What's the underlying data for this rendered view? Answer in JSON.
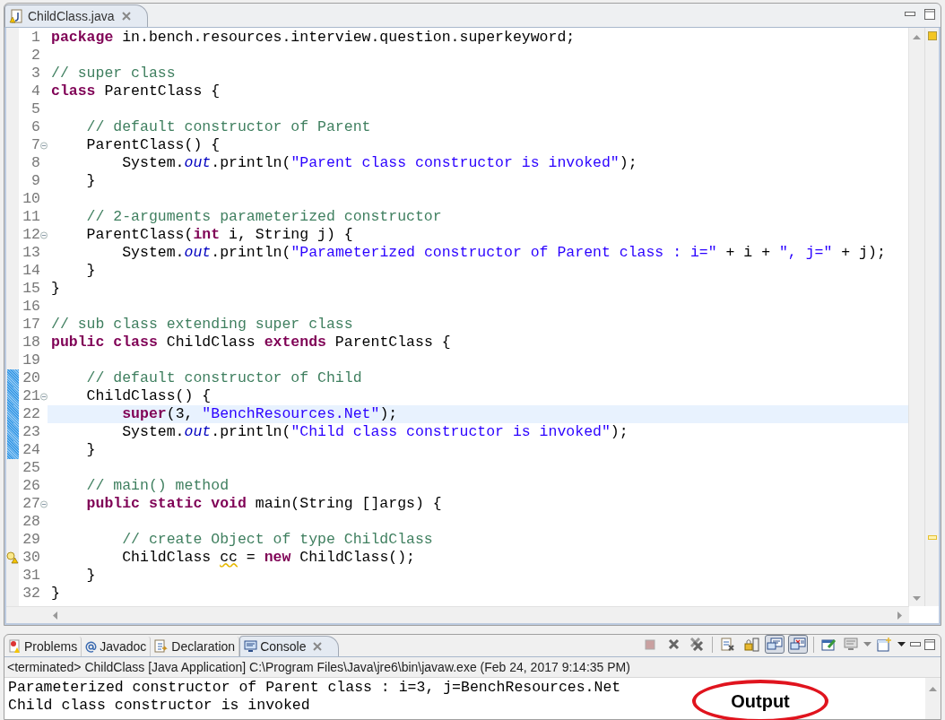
{
  "editor_tab": {
    "label": "ChildClass.java",
    "selected": true
  },
  "lines": [
    {
      "n": "1",
      "fold": false,
      "changed": false,
      "current": false,
      "warning": false,
      "tokens": [
        {
          "kind": "kw",
          "text": "package"
        },
        {
          "kind": "plain",
          "text": " in.bench.resources.interview.question.superkeyword;"
        }
      ]
    },
    {
      "n": "2",
      "fold": false,
      "changed": false,
      "current": false,
      "warning": false
    },
    {
      "n": "3",
      "fold": false,
      "changed": false,
      "current": false,
      "warning": false,
      "tokens": [
        {
          "kind": "comment",
          "text": "// super class"
        }
      ]
    },
    {
      "n": "4",
      "fold": false,
      "changed": false,
      "current": false,
      "warning": false,
      "tokens": [
        {
          "kind": "kw",
          "text": "class"
        },
        {
          "kind": "plain",
          "text": " ParentClass {"
        }
      ]
    },
    {
      "n": "5",
      "fold": false,
      "changed": false,
      "current": false,
      "warning": false
    },
    {
      "n": "6",
      "fold": false,
      "changed": false,
      "current": false,
      "warning": false,
      "tokens": [
        {
          "kind": "comment",
          "text": "    // default constructor of Parent"
        }
      ]
    },
    {
      "n": "7",
      "fold": true,
      "changed": false,
      "current": false,
      "warning": false,
      "tokens": [
        {
          "kind": "plain",
          "text": "    ParentClass() {"
        }
      ]
    },
    {
      "n": "8",
      "fold": false,
      "changed": false,
      "current": false,
      "warning": false,
      "tokens": [
        {
          "kind": "plain",
          "text": "        System."
        },
        {
          "kind": "field",
          "text": "out"
        },
        {
          "kind": "plain",
          "text": ".println("
        },
        {
          "kind": "string",
          "text": "\"Parent class constructor is invoked\""
        },
        {
          "kind": "plain",
          "text": ");"
        }
      ]
    },
    {
      "n": "9",
      "fold": false,
      "changed": false,
      "current": false,
      "warning": false,
      "tokens": [
        {
          "kind": "plain",
          "text": "    }"
        }
      ]
    },
    {
      "n": "10",
      "fold": false,
      "changed": false,
      "current": false,
      "warning": false
    },
    {
      "n": "11",
      "fold": false,
      "changed": false,
      "current": false,
      "warning": false,
      "tokens": [
        {
          "kind": "comment",
          "text": "    // 2-arguments parameterized constructor"
        }
      ]
    },
    {
      "n": "12",
      "fold": true,
      "changed": false,
      "current": false,
      "warning": false,
      "tokens": [
        {
          "kind": "plain",
          "text": "    ParentClass("
        },
        {
          "kind": "kw",
          "text": "int"
        },
        {
          "kind": "plain",
          "text": " i, String j) {"
        }
      ]
    },
    {
      "n": "13",
      "fold": false,
      "changed": false,
      "current": false,
      "warning": false,
      "tokens": [
        {
          "kind": "plain",
          "text": "        System."
        },
        {
          "kind": "field",
          "text": "out"
        },
        {
          "kind": "plain",
          "text": ".println("
        },
        {
          "kind": "string",
          "text": "\"Parameterized constructor of Parent class : i=\""
        },
        {
          "kind": "plain",
          "text": " + i + "
        },
        {
          "kind": "string",
          "text": "\", j=\""
        },
        {
          "kind": "plain",
          "text": " + j);"
        }
      ]
    },
    {
      "n": "14",
      "fold": false,
      "changed": false,
      "current": false,
      "warning": false,
      "tokens": [
        {
          "kind": "plain",
          "text": "    }"
        }
      ]
    },
    {
      "n": "15",
      "fold": false,
      "changed": false,
      "current": false,
      "warning": false,
      "tokens": [
        {
          "kind": "plain",
          "text": "}"
        }
      ]
    },
    {
      "n": "16",
      "fold": false,
      "changed": false,
      "current": false,
      "warning": false
    },
    {
      "n": "17",
      "fold": false,
      "changed": false,
      "current": false,
      "warning": false,
      "tokens": [
        {
          "kind": "comment",
          "text": "// sub class extending super class"
        }
      ]
    },
    {
      "n": "18",
      "fold": false,
      "changed": false,
      "current": false,
      "warning": false,
      "tokens": [
        {
          "kind": "kw",
          "text": "public class"
        },
        {
          "kind": "plain",
          "text": " ChildClass "
        },
        {
          "kind": "kw",
          "text": "extends"
        },
        {
          "kind": "plain",
          "text": " ParentClass {"
        }
      ]
    },
    {
      "n": "19",
      "fold": false,
      "changed": false,
      "current": false,
      "warning": false
    },
    {
      "n": "20",
      "fold": false,
      "changed": true,
      "current": false,
      "warning": false,
      "tokens": [
        {
          "kind": "comment",
          "text": "    // default constructor of Child"
        }
      ]
    },
    {
      "n": "21",
      "fold": true,
      "changed": true,
      "current": false,
      "warning": false,
      "tokens": [
        {
          "kind": "plain",
          "text": "    ChildClass() {"
        }
      ]
    },
    {
      "n": "22",
      "fold": false,
      "changed": true,
      "current": true,
      "warning": false,
      "tokens": [
        {
          "kind": "kw",
          "text": "        super"
        },
        {
          "kind": "plain",
          "text": "(3, "
        },
        {
          "kind": "string",
          "text": "\"BenchResources.Net\""
        },
        {
          "kind": "plain",
          "text": ");"
        }
      ]
    },
    {
      "n": "23",
      "fold": false,
      "changed": true,
      "current": false,
      "warning": false,
      "tokens": [
        {
          "kind": "plain",
          "text": "        System."
        },
        {
          "kind": "field",
          "text": "out"
        },
        {
          "kind": "plain",
          "text": ".println("
        },
        {
          "kind": "string",
          "text": "\"Child class constructor is invoked\""
        },
        {
          "kind": "plain",
          "text": ");"
        }
      ]
    },
    {
      "n": "24",
      "fold": false,
      "changed": true,
      "current": false,
      "warning": false,
      "tokens": [
        {
          "kind": "plain",
          "text": "    }"
        }
      ]
    },
    {
      "n": "25",
      "fold": false,
      "changed": false,
      "current": false,
      "warning": false
    },
    {
      "n": "26",
      "fold": false,
      "changed": false,
      "current": false,
      "warning": false,
      "tokens": [
        {
          "kind": "comment",
          "text": "    // main() method"
        }
      ]
    },
    {
      "n": "27",
      "fold": true,
      "changed": false,
      "current": false,
      "warning": false,
      "tokens": [
        {
          "kind": "kw",
          "text": "    public static void"
        },
        {
          "kind": "plain",
          "text": " main(String []args) {"
        }
      ]
    },
    {
      "n": "28",
      "fold": false,
      "changed": false,
      "current": false,
      "warning": false
    },
    {
      "n": "29",
      "fold": false,
      "changed": false,
      "current": false,
      "warning": false,
      "tokens": [
        {
          "kind": "comment",
          "text": "        // create Object of type ChildClass"
        }
      ]
    },
    {
      "n": "30",
      "fold": false,
      "changed": false,
      "current": false,
      "warning": true,
      "tokens": [
        {
          "kind": "plain",
          "text": "        ChildClass "
        },
        {
          "kind": "warn",
          "text": "cc"
        },
        {
          "kind": "plain",
          "text": " = "
        },
        {
          "kind": "kw",
          "text": "new"
        },
        {
          "kind": "plain",
          "text": " ChildClass();"
        }
      ]
    },
    {
      "n": "31",
      "fold": false,
      "changed": false,
      "current": false,
      "warning": false,
      "tokens": [
        {
          "kind": "plain",
          "text": "    }"
        }
      ]
    },
    {
      "n": "32",
      "fold": false,
      "changed": false,
      "current": false,
      "warning": false,
      "tokens": [
        {
          "kind": "plain",
          "text": "}"
        }
      ]
    }
  ],
  "panel_tabs": [
    {
      "kind": "problems",
      "label": "Problems",
      "selected": false
    },
    {
      "kind": "javadoc",
      "label": "Javadoc",
      "selected": false
    },
    {
      "kind": "declaration",
      "label": "Declaration",
      "selected": false
    },
    {
      "kind": "console",
      "label": "Console",
      "selected": true
    }
  ],
  "console_toolbar": [
    [
      {
        "kind": "stop",
        "pressed": false
      },
      {
        "kind": "remove",
        "pressed": false
      },
      {
        "kind": "remove-all",
        "pressed": false
      }
    ],
    [
      {
        "kind": "clear",
        "pressed": false
      },
      {
        "kind": "lock",
        "pressed": false
      },
      {
        "kind": "out",
        "pressed": true
      },
      {
        "kind": "err",
        "pressed": true
      }
    ],
    [
      {
        "kind": "pin",
        "pressed": false
      },
      {
        "kind": "monitor-menu",
        "pressed": false
      },
      {
        "kind": "new-menu",
        "pressed": false
      }
    ]
  ],
  "console_header": "<terminated> ChildClass [Java Application] C:\\Program Files\\Java\\jre6\\bin\\javaw.exe (Feb 24, 2017 9:14:35 PM)",
  "console_output": [
    "Parameterized constructor of Parent class : i=3, j=BenchResources.Net",
    "Child class constructor is invoked"
  ],
  "annotation": "Output"
}
